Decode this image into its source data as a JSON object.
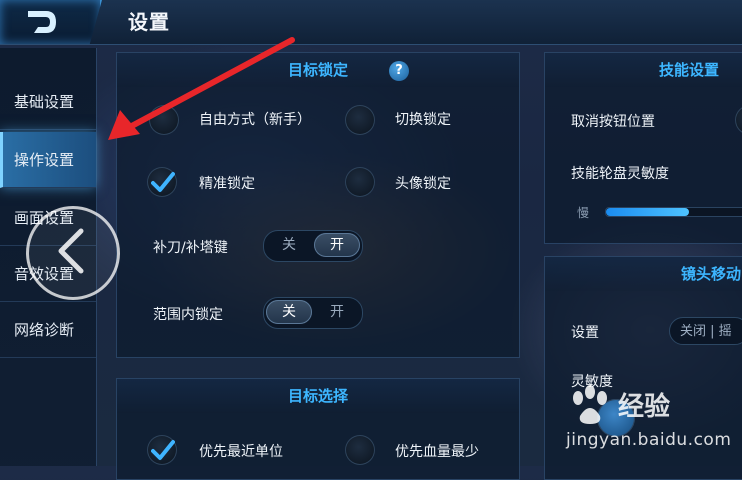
{
  "header": {
    "title": "设置",
    "back_icon": "back-d-icon"
  },
  "sidebar": {
    "items": [
      {
        "label": "基础设置"
      },
      {
        "label": "操作设置",
        "active": true
      },
      {
        "label": "画面设置"
      },
      {
        "label": "音效设置"
      },
      {
        "label": "网络诊断"
      }
    ]
  },
  "target_lock": {
    "title": "目标锁定",
    "help": "?",
    "options": {
      "free_mode": "自由方式（新手）",
      "switch_lock": "切换锁定",
      "precise_lock": "精准锁定",
      "avatar_lock": "头像锁定"
    },
    "selected": "precise_lock",
    "last_hit_label": "补刀/补塔键",
    "last_hit": {
      "off": "关",
      "on": "开",
      "value": "on"
    },
    "range_lock_label": "范围内锁定",
    "range_lock": {
      "off": "关",
      "on": "开",
      "value": "off"
    }
  },
  "target_select": {
    "title": "目标选择",
    "options": {
      "nearest": "优先最近单位",
      "lowest_hp": "优先血量最少"
    },
    "selected": "nearest"
  },
  "skill_settings": {
    "title": "技能设置",
    "cancel_pos_label": "取消按钮位置",
    "wheel_sens_label": "技能轮盘灵敏度",
    "slow_label": "慢",
    "wheel_sensitivity": 0.55
  },
  "camera_move": {
    "title": "镜头移动",
    "setting_label": "设置",
    "setting_options": "关闭 | 摇",
    "sens_label": "灵敏度"
  },
  "watermark": {
    "brand": "经验",
    "url": "jingyan.baidu.com"
  },
  "colors": {
    "accent": "#3db6ff",
    "annotation_arrow": "#e8262a"
  }
}
